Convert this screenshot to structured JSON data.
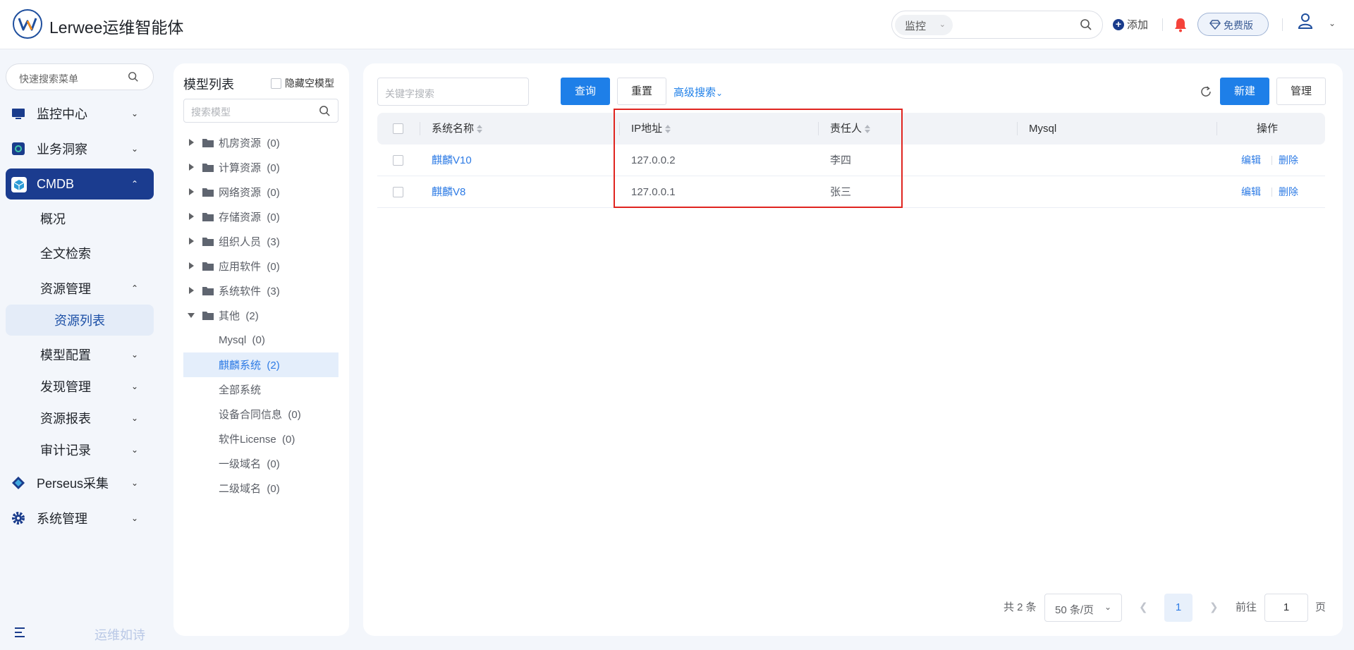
{
  "header": {
    "app_title": "Lerwee运维智能体",
    "search_select": "监控",
    "add_label": "添加",
    "free_label": "免费版"
  },
  "sidebar": {
    "search_placeholder": "快速搜索菜单",
    "items": [
      {
        "label": "监控中心"
      },
      {
        "label": "业务洞察"
      },
      {
        "label": "CMDB"
      },
      {
        "label": "概况"
      },
      {
        "label": "全文检索"
      },
      {
        "label": "资源管理"
      },
      {
        "label": "资源列表"
      },
      {
        "label": "模型配置"
      },
      {
        "label": "发现管理"
      },
      {
        "label": "资源报表"
      },
      {
        "label": "审计记录"
      },
      {
        "label": "Perseus采集"
      },
      {
        "label": "系统管理"
      }
    ],
    "footer_text": "运维如诗"
  },
  "model_panel": {
    "title": "模型列表",
    "hide_empty_label": "隐藏空模型",
    "search_placeholder": "搜索模型",
    "tree": [
      {
        "label": "机房资源",
        "count": "(0)"
      },
      {
        "label": "计算资源",
        "count": "(0)"
      },
      {
        "label": "网络资源",
        "count": "(0)"
      },
      {
        "label": "存储资源",
        "count": "(0)"
      },
      {
        "label": "组织人员",
        "count": "(3)"
      },
      {
        "label": "应用软件",
        "count": "(0)"
      },
      {
        "label": "系统软件",
        "count": "(3)"
      },
      {
        "label": "其他",
        "count": "(2)"
      },
      {
        "label": "Mysql",
        "count": "(0)"
      },
      {
        "label": "麒麟系统",
        "count": "(2)"
      },
      {
        "label": "全部系统",
        "count": ""
      },
      {
        "label": "设备合同信息",
        "count": "(0)"
      },
      {
        "label": "软件License",
        "count": "(0)"
      },
      {
        "label": "一级域名",
        "count": "(0)"
      },
      {
        "label": "二级域名",
        "count": "(0)"
      }
    ]
  },
  "toolbar": {
    "keyword_placeholder": "关键字搜索",
    "query_label": "查询",
    "reset_label": "重置",
    "advanced_label": "高级搜索",
    "new_label": "新建",
    "manage_label": "管理"
  },
  "table": {
    "columns": [
      "系统名称",
      "IP地址",
      "责任人",
      "Mysql",
      "操作"
    ],
    "rows": [
      {
        "name": "麒麟V10",
        "ip": "127.0.0.2",
        "owner": "李四",
        "mysql": ""
      },
      {
        "name": "麒麟V8",
        "ip": "127.0.0.1",
        "owner": "张三",
        "mysql": ""
      }
    ],
    "edit_label": "编辑",
    "delete_label": "删除"
  },
  "pagination": {
    "total": "共 2 条",
    "page_size": "50 条/页",
    "current_page": "1",
    "goto_label": "前往",
    "goto_value": "1",
    "page_suffix": "页"
  },
  "colors": {
    "primary": "#1e7fe8",
    "nav_active": "#1b3c8f",
    "highlight_border": "#e0241f",
    "link": "#2d7be5"
  }
}
